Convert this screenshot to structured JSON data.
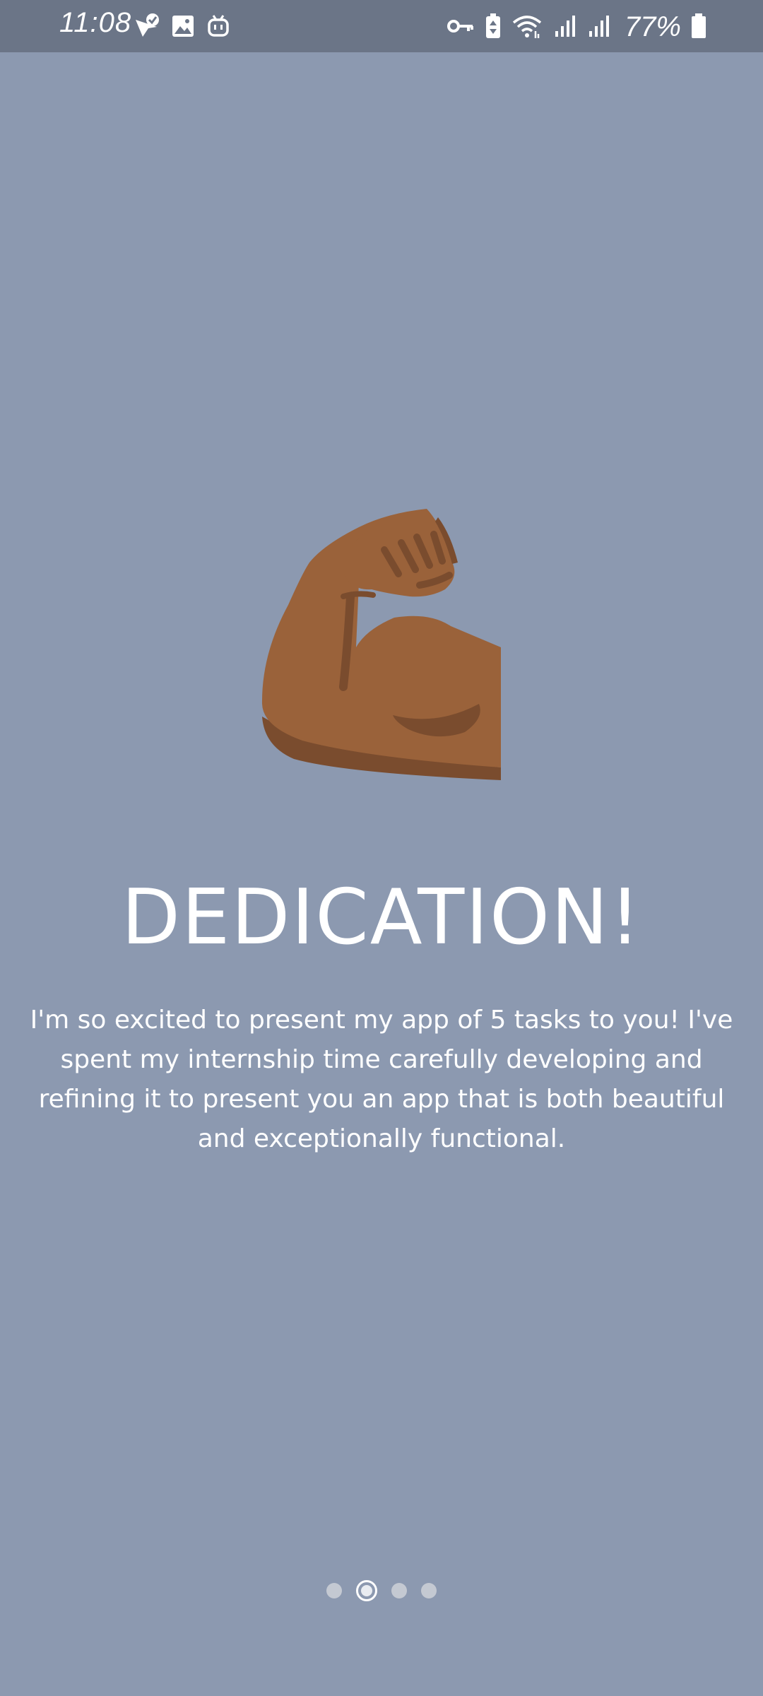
{
  "status_bar": {
    "time": "11:08",
    "battery": "77%",
    "left_icons": [
      "check-badge-icon",
      "image-icon",
      "robot-icon"
    ],
    "right_icons": [
      "key-icon",
      "battery-saver-icon",
      "wifi-icon",
      "signal-icon",
      "signal-icon",
      "battery-icon"
    ]
  },
  "hero": {
    "icon": "flexed-biceps-icon"
  },
  "onboarding": {
    "title": "DEDICATION!",
    "description": "I'm so excited to present my app of 5 tasks to you! I've spent my internship time carefully developing and refining it to present you an app that is both beautiful and exceptionally functional."
  },
  "pager": {
    "count": 4,
    "active_index": 1
  },
  "colors": {
    "background": "#8c99b0",
    "status_bar": "#6b7587",
    "arm": "#9a623a",
    "arm_shadow": "#7a4c2e",
    "text": "#ffffff"
  }
}
